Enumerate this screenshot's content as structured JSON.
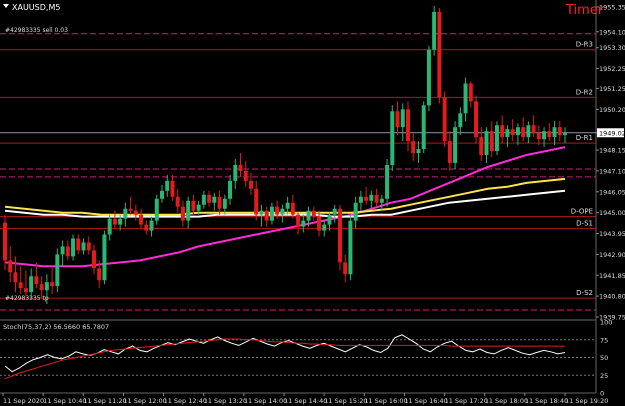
{
  "window": {
    "symbol_label": "XAUUSD,M5",
    "timer_label": "Timer",
    "symbol_menu_icon": "triangle-down-icon"
  },
  "colors": {
    "background": "#000000",
    "grid": "#2a2a2a",
    "bull_candle": "#2bb673",
    "bear_candle": "#e21b1b",
    "level_line": "#b01818",
    "magenta_ma": "#ff2bd6",
    "yellow_ma": "#ffe34a",
    "white_ma": "#ffffff",
    "current_price_line": "#8899aa",
    "stoch_main": "#ffffff",
    "stoch_signal": "#e21b1b",
    "timer": "#ff2020"
  },
  "main_panel": {
    "pivot_levels": [
      {
        "name": "D-R3",
        "price": 1953.2
      },
      {
        "name": "D-R2",
        "price": 1950.8
      },
      {
        "name": "D-R1",
        "price": 1948.5
      },
      {
        "name": "D-OPE",
        "price": 1944.8
      },
      {
        "name": "D-S1",
        "price": 1944.2
      },
      {
        "name": "D-S2",
        "price": 1940.7
      }
    ],
    "dashed_levels": [
      1954.0,
      1947.2,
      1946.8,
      1940.1
    ],
    "order_annotations": [
      {
        "text": "#42983335 sell 0.03",
        "price": 1954.0
      },
      {
        "text": "#42983335 tp",
        "price": 1940.5
      }
    ],
    "current_price": 1949.02,
    "price_ticks": [
      "1955.35",
      "1954.10",
      "1953.30",
      "1952.25",
      "1951.25",
      "1950.20",
      "1949.02",
      "1948.15",
      "1947.10",
      "1946.05",
      "1945.00",
      "1943.95",
      "1942.90",
      "1941.85",
      "1940.80",
      "1939.75"
    ]
  },
  "chart_data": {
    "type": "candlestick",
    "symbol": "XAUUSD",
    "timeframe": "M5",
    "ylim": [
      1939.7,
      1955.6
    ],
    "candles": [
      [
        1944.5,
        1944.9,
        1942.1,
        1942.6
      ],
      [
        1942.6,
        1943.3,
        1941.5,
        1942.0
      ],
      [
        1942.0,
        1942.8,
        1941.0,
        1941.5
      ],
      [
        1941.5,
        1942.3,
        1940.9,
        1941.2
      ],
      [
        1941.2,
        1942.1,
        1940.8,
        1941.0
      ],
      [
        1941.0,
        1942.2,
        1940.6,
        1941.8
      ],
      [
        1941.8,
        1942.5,
        1941.2,
        1941.4
      ],
      [
        1941.4,
        1941.8,
        1940.7,
        1941.1
      ],
      [
        1941.1,
        1941.9,
        1940.4,
        1941.5
      ],
      [
        1941.5,
        1942.3,
        1940.9,
        1941.3
      ],
      [
        1941.3,
        1943.2,
        1941.0,
        1942.9
      ],
      [
        1942.9,
        1943.6,
        1942.3,
        1943.3
      ],
      [
        1943.3,
        1943.6,
        1942.6,
        1942.8
      ],
      [
        1942.8,
        1943.9,
        1942.6,
        1943.7
      ],
      [
        1943.7,
        1943.9,
        1942.9,
        1943.1
      ],
      [
        1943.1,
        1943.7,
        1942.9,
        1943.5
      ],
      [
        1943.5,
        1943.8,
        1942.9,
        1943.1
      ],
      [
        1943.1,
        1943.4,
        1941.9,
        1942.2
      ],
      [
        1942.2,
        1942.6,
        1941.2,
        1941.6
      ],
      [
        1941.6,
        1944.1,
        1941.4,
        1943.9
      ],
      [
        1943.9,
        1944.9,
        1943.6,
        1944.7
      ],
      [
        1944.7,
        1945.1,
        1944.2,
        1944.4
      ],
      [
        1944.4,
        1944.9,
        1944.1,
        1944.7
      ],
      [
        1944.7,
        1945.5,
        1944.3,
        1945.2
      ],
      [
        1945.2,
        1945.8,
        1944.9,
        1945.1
      ],
      [
        1945.1,
        1945.4,
        1944.6,
        1944.9
      ],
      [
        1944.9,
        1945.2,
        1944.2,
        1944.4
      ],
      [
        1944.4,
        1944.6,
        1943.9,
        1944.1
      ],
      [
        1944.1,
        1944.8,
        1943.8,
        1944.6
      ],
      [
        1944.6,
        1945.9,
        1944.4,
        1945.7
      ],
      [
        1945.7,
        1946.4,
        1945.5,
        1946.1
      ],
      [
        1946.1,
        1946.9,
        1945.8,
        1946.6
      ],
      [
        1946.6,
        1946.9,
        1945.6,
        1945.8
      ],
      [
        1945.8,
        1946.2,
        1945.0,
        1945.3
      ],
      [
        1945.3,
        1945.6,
        1944.3,
        1944.6
      ],
      [
        1944.6,
        1945.8,
        1944.2,
        1945.6
      ],
      [
        1945.6,
        1945.9,
        1944.9,
        1945.1
      ],
      [
        1945.1,
        1945.6,
        1944.9,
        1945.4
      ],
      [
        1945.4,
        1946.1,
        1945.2,
        1945.9
      ],
      [
        1945.9,
        1946.1,
        1945.3,
        1945.5
      ],
      [
        1945.5,
        1946.0,
        1945.1,
        1945.8
      ],
      [
        1945.8,
        1946.1,
        1944.9,
        1945.2
      ],
      [
        1945.2,
        1945.9,
        1944.9,
        1945.7
      ],
      [
        1945.7,
        1946.9,
        1945.4,
        1946.6
      ],
      [
        1946.6,
        1947.7,
        1946.2,
        1947.4
      ],
      [
        1947.4,
        1948.0,
        1946.8,
        1947.1
      ],
      [
        1947.1,
        1947.6,
        1946.3,
        1946.6
      ],
      [
        1946.6,
        1947.0,
        1945.9,
        1946.2
      ],
      [
        1946.2,
        1946.6,
        1944.6,
        1944.9
      ],
      [
        1944.9,
        1945.4,
        1944.3,
        1945.1
      ],
      [
        1945.1,
        1945.3,
        1944.3,
        1944.6
      ],
      [
        1944.6,
        1945.5,
        1944.4,
        1945.3
      ],
      [
        1945.3,
        1945.6,
        1944.7,
        1944.9
      ],
      [
        1944.9,
        1945.4,
        1944.5,
        1945.2
      ],
      [
        1945.2,
        1945.8,
        1944.9,
        1945.5
      ],
      [
        1945.5,
        1945.9,
        1944.7,
        1944.9
      ],
      [
        1944.9,
        1945.0,
        1943.9,
        1944.3
      ],
      [
        1944.3,
        1944.9,
        1944.0,
        1944.6
      ],
      [
        1944.6,
        1945.3,
        1944.3,
        1945.1
      ],
      [
        1945.1,
        1945.3,
        1944.6,
        1944.8
      ],
      [
        1944.8,
        1945.1,
        1943.8,
        1944.1
      ],
      [
        1944.1,
        1944.6,
        1943.8,
        1944.4
      ],
      [
        1944.4,
        1945.0,
        1944.1,
        1944.9
      ],
      [
        1944.9,
        1945.4,
        1944.5,
        1945.2
      ],
      [
        1945.2,
        1945.4,
        1942.1,
        1942.5
      ],
      [
        1942.5,
        1942.9,
        1941.5,
        1941.9
      ],
      [
        1941.9,
        1944.9,
        1941.6,
        1944.6
      ],
      [
        1944.6,
        1945.8,
        1944.2,
        1945.5
      ],
      [
        1945.5,
        1946.1,
        1945.1,
        1945.8
      ],
      [
        1945.8,
        1946.3,
        1945.4,
        1945.6
      ],
      [
        1945.6,
        1946.1,
        1945.2,
        1945.9
      ],
      [
        1945.9,
        1946.2,
        1945.3,
        1945.5
      ],
      [
        1945.5,
        1945.9,
        1945.1,
        1945.7
      ],
      [
        1945.7,
        1947.7,
        1945.3,
        1947.4
      ],
      [
        1947.4,
        1950.4,
        1947.1,
        1950.1
      ],
      [
        1950.1,
        1950.6,
        1948.9,
        1949.3
      ],
      [
        1949.3,
        1950.5,
        1948.6,
        1950.2
      ],
      [
        1950.2,
        1950.6,
        1948.1,
        1948.6
      ],
      [
        1948.6,
        1949.0,
        1947.6,
        1948.0
      ],
      [
        1948.0,
        1948.6,
        1947.5,
        1948.2
      ],
      [
        1948.2,
        1950.6,
        1948.0,
        1950.4
      ],
      [
        1950.4,
        1953.4,
        1950.1,
        1953.2
      ],
      [
        1953.2,
        1955.4,
        1952.9,
        1955.1
      ],
      [
        1955.1,
        1955.3,
        1950.5,
        1950.8
      ],
      [
        1950.8,
        1951.1,
        1948.3,
        1948.6
      ],
      [
        1948.6,
        1949.1,
        1947.1,
        1947.5
      ],
      [
        1947.5,
        1949.6,
        1947.2,
        1949.3
      ],
      [
        1949.3,
        1950.3,
        1948.9,
        1950.0
      ],
      [
        1950.0,
        1951.8,
        1949.6,
        1951.5
      ],
      [
        1951.5,
        1951.6,
        1950.3,
        1950.6
      ],
      [
        1950.6,
        1950.9,
        1948.5,
        1948.8
      ],
      [
        1948.8,
        1949.3,
        1947.6,
        1947.9
      ],
      [
        1947.9,
        1949.3,
        1947.5,
        1949.1
      ],
      [
        1949.1,
        1949.6,
        1947.8,
        1948.1
      ],
      [
        1948.1,
        1949.6,
        1947.9,
        1949.4
      ],
      [
        1949.4,
        1949.9,
        1948.5,
        1948.8
      ],
      [
        1948.8,
        1949.4,
        1948.3,
        1949.2
      ],
      [
        1949.2,
        1949.7,
        1948.6,
        1948.9
      ],
      [
        1948.9,
        1949.5,
        1948.4,
        1949.3
      ],
      [
        1949.3,
        1949.8,
        1948.6,
        1948.8
      ],
      [
        1948.8,
        1949.6,
        1948.5,
        1949.4
      ],
      [
        1949.4,
        1949.9,
        1948.8,
        1949.0
      ],
      [
        1949.0,
        1949.4,
        1948.4,
        1948.7
      ],
      [
        1948.7,
        1949.3,
        1948.3,
        1949.1
      ],
      [
        1949.1,
        1949.5,
        1948.6,
        1948.8
      ],
      [
        1948.8,
        1949.6,
        1948.4,
        1949.3
      ],
      [
        1949.3,
        1949.6,
        1948.6,
        1948.9
      ],
      [
        1948.9,
        1949.3,
        1948.5,
        1949.0
      ]
    ],
    "ma_series": [
      {
        "color": "#ff2bd6",
        "values": [
          1942.5,
          1942.4,
          1942.3,
          1942.3,
          1942.3,
          1942.4,
          1942.5,
          1942.6,
          1942.8,
          1943.0,
          1943.3,
          1943.5,
          1943.7,
          1943.9,
          1944.1,
          1944.3,
          1944.5,
          1944.7,
          1944.9,
          1945.2,
          1945.5,
          1945.7,
          1946.1,
          1946.5,
          1946.9,
          1947.3,
          1947.6,
          1947.9,
          1948.1,
          1948.3
        ]
      },
      {
        "color": "#ffe34a",
        "values": [
          1945.3,
          1945.2,
          1945.1,
          1945.0,
          1945.0,
          1944.9,
          1944.9,
          1944.9,
          1944.9,
          1944.9,
          1945.0,
          1945.0,
          1945.0,
          1945.0,
          1945.0,
          1945.0,
          1945.0,
          1945.0,
          1945.0,
          1945.1,
          1945.2,
          1945.4,
          1945.6,
          1945.8,
          1946.0,
          1946.2,
          1946.3,
          1946.5,
          1946.6,
          1946.7
        ]
      },
      {
        "color": "#ffffff",
        "values": [
          1945.1,
          1945.0,
          1944.9,
          1944.9,
          1944.8,
          1944.8,
          1944.8,
          1944.8,
          1944.8,
          1944.8,
          1944.8,
          1944.9,
          1944.9,
          1944.9,
          1944.9,
          1944.9,
          1944.9,
          1944.8,
          1944.8,
          1944.9,
          1944.9,
          1945.1,
          1945.3,
          1945.5,
          1945.6,
          1945.7,
          1945.8,
          1945.9,
          1946.0,
          1946.1
        ]
      }
    ],
    "x_tick_labels": [
      "11 Sep 2020",
      "11 Sep 10:40",
      "11 Sep 11:20",
      "11 Sep 12:00",
      "11 Sep 12:40",
      "11 Sep 13:20",
      "11 Sep 14:00",
      "11 Sep 14:40",
      "11 Sep 15:20",
      "11 Sep 16:00",
      "11 Sep 16:40",
      "11 Sep 17:20",
      "11 Sep 18:00",
      "11 Sep 18:40",
      "11 Sep 19:20"
    ],
    "stochastic": {
      "label": "Stoch(75,37,2) 56.5660 65.7807",
      "ylim": [
        0,
        100
      ],
      "levels": [
        75,
        50,
        25
      ],
      "tick_labels": [
        "100",
        "75",
        "50",
        "25",
        "0"
      ],
      "main": [
        38,
        30,
        35,
        42,
        47,
        50,
        54,
        50,
        48,
        52,
        58,
        55,
        53,
        56,
        61,
        58,
        55,
        62,
        66,
        60,
        58,
        63,
        67,
        71,
        68,
        72,
        76,
        73,
        70,
        75,
        79,
        74,
        70,
        67,
        72,
        77,
        73,
        69,
        66,
        71,
        74,
        70,
        66,
        63,
        67,
        70,
        66,
        62,
        58,
        63,
        68,
        65,
        60,
        57,
        63,
        78,
        82,
        76,
        70,
        62,
        58,
        65,
        70,
        73,
        66,
        60,
        58,
        62,
        57,
        55,
        60,
        64,
        60,
        56,
        54,
        57,
        60,
        58,
        55,
        57
      ],
      "signal": [
        20,
        24,
        28,
        31,
        34,
        37,
        40,
        43,
        46,
        48,
        50,
        52,
        54,
        56,
        58,
        60,
        61,
        62,
        63,
        64,
        65,
        66,
        67,
        68,
        69,
        70,
        71,
        72,
        73,
        74,
        75,
        76,
        76,
        76,
        75,
        75,
        74,
        73,
        72,
        72,
        71,
        70,
        70,
        69,
        69,
        68,
        68,
        67,
        67,
        67,
        67,
        67,
        67,
        67,
        67,
        67,
        67,
        67,
        67,
        67,
        67,
        67,
        67,
        66,
        66,
        66,
        66,
        66,
        66,
        66,
        66,
        66,
        66,
        66,
        66,
        66,
        66,
        66,
        66,
        66
      ]
    }
  }
}
